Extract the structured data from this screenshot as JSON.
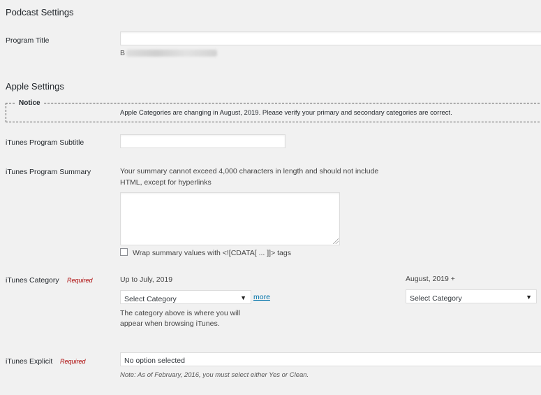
{
  "podcast": {
    "heading": "Podcast Settings",
    "program_title_label": "Program Title",
    "program_title_value": "",
    "program_title_hint_prefix": "B"
  },
  "apple": {
    "heading": "Apple Settings",
    "notice_legend": "Notice",
    "notice_text": "Apple Categories are changing in August, 2019. Please verify your primary and secondary categories are correct.",
    "subtitle_label": "iTunes Program Subtitle",
    "subtitle_value": "",
    "summary_label": "iTunes Program Summary",
    "summary_desc_line1": "Your summary cannot exceed 4,000 characters in length and should not include",
    "summary_desc_line2": "HTML, except for hyperlinks",
    "summary_value": "",
    "cdata_checkbox_label": "Wrap summary values with <![CDATA[ ... ]]> tags",
    "cdata_checked": false,
    "category_label": "iTunes Category",
    "required_text": "Required",
    "category_old_heading": "Up to July, 2019",
    "category_old_selected": "Select Category",
    "more_link": "more",
    "category_help_line1": "The category above is where you will",
    "category_help_line2": "appear when browsing iTunes.",
    "category_new_heading": "August, 2019 +",
    "category_new_selected": "Select Category",
    "explicit_label": "iTunes Explicit",
    "explicit_selected": "No option selected",
    "explicit_note": "Note: As of February, 2016, you must select either Yes or Clean."
  },
  "icons": {
    "dropdown": "chevron-down-icon",
    "resize": "resize-handle-icon"
  },
  "colors": {
    "background": "#f1f1f1",
    "required": "#aa0000",
    "link": "#0073aa"
  }
}
